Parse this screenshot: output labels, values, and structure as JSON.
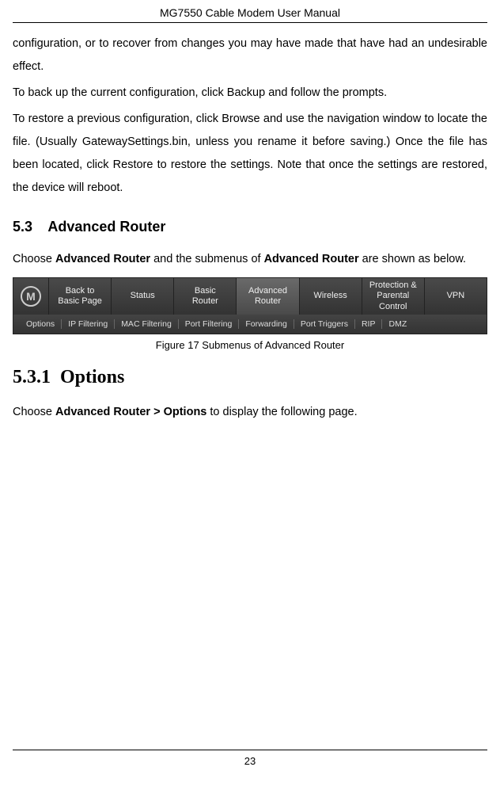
{
  "header": {
    "title": "MG7550 Cable Modem User Manual"
  },
  "body": {
    "p1": "configuration, or to recover from changes you may have made that have had an undesirable effect.",
    "p2": "To back up the current configuration, click Backup and follow the prompts.",
    "p3": "To restore a previous configuration, click Browse and use the navigation window to locate the file.  (Usually GatewaySettings.bin,  unless you rename it before saving.)  Once the file has been located, click Restore to restore the settings.  Note that once the settings are restored, the device will reboot."
  },
  "section": {
    "number": "5.3",
    "title": "Advanced Router",
    "intro_pre": "Choose ",
    "intro_bold1": "Advanced Router",
    "intro_mid": " and the submenus of ",
    "intro_bold2": "Advanced Router",
    "intro_post": " are shown as below."
  },
  "nav": {
    "items": [
      "Back to\nBasic Page",
      "Status",
      "Basic\nRouter",
      "Advanced\nRouter",
      "Wireless",
      "Protection &\nParental Control",
      "VPN"
    ],
    "active_index": 3,
    "sub_items": [
      "Options",
      "IP Filtering",
      "MAC Filtering",
      "Port Filtering",
      "Forwarding",
      "Port Triggers",
      "RIP",
      "DMZ"
    ]
  },
  "figure_caption": "Figure 17 Submenus of Advanced Router",
  "subsection": {
    "number": "5.3.1",
    "title": "Options",
    "text_pre": "Choose ",
    "text_bold": "Advanced Router > Options",
    "text_post": " to display the following page."
  },
  "page_number": "23"
}
